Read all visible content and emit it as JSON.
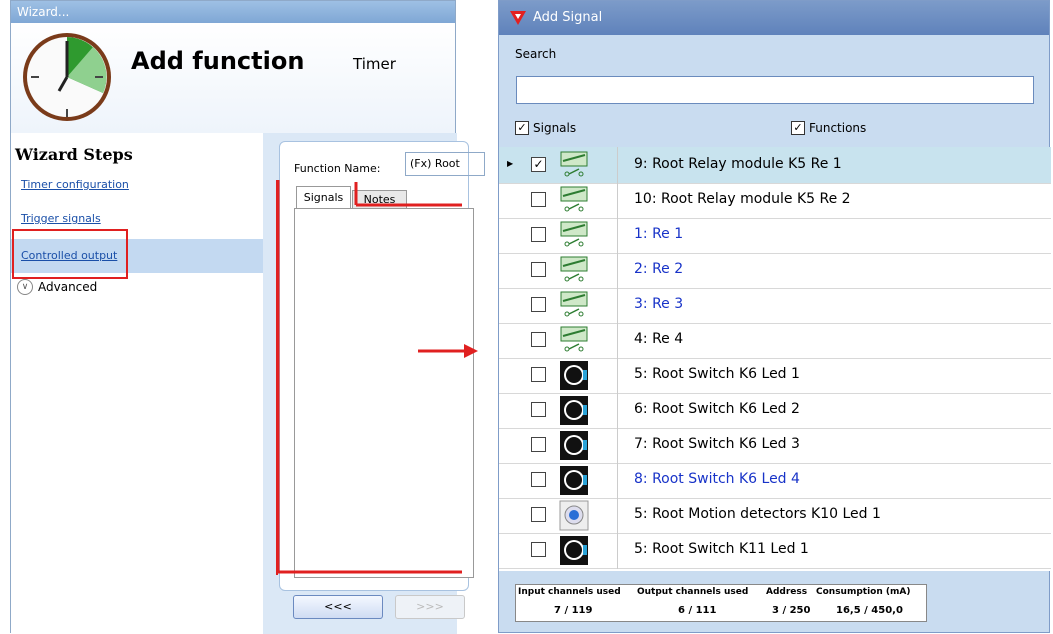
{
  "wizard": {
    "title": "Wizard...",
    "heading": "Add function",
    "subheading": "Timer",
    "steps_title": "Wizard Steps",
    "steps": [
      {
        "label": "Timer configuration"
      },
      {
        "label": "Trigger signals"
      },
      {
        "label": "Controlled output"
      }
    ],
    "advanced_label": "Advanced",
    "function_name_label": "Function Name:",
    "function_name_value": "(Fx) Root",
    "tabs": [
      {
        "label": "Signals"
      },
      {
        "label": "Notes"
      }
    ],
    "back_button": "<<<",
    "next_button": ">>>"
  },
  "add_signal": {
    "title": "Add Signal",
    "search_label": "Search",
    "search_value": "",
    "filter_signals": "Signals",
    "filter_functions": "Functions",
    "rows": [
      {
        "label": "9: Root Relay module K5 Re 1",
        "checked": true,
        "icon": "relay-icon",
        "color": "#000000"
      },
      {
        "label": "10: Root Relay module K5 Re 2",
        "checked": false,
        "icon": "relay-icon",
        "color": "#000000"
      },
      {
        "label": "1: Re 1",
        "checked": false,
        "icon": "relay-icon",
        "color": "#1833c8"
      },
      {
        "label": "2: Re 2",
        "checked": false,
        "icon": "relay-icon",
        "color": "#1833c8"
      },
      {
        "label": "3: Re 3",
        "checked": false,
        "icon": "relay-icon",
        "color": "#1833c8"
      },
      {
        "label": "4: Re 4",
        "checked": false,
        "icon": "relay-icon",
        "color": "#000000"
      },
      {
        "label": "5: Root Switch K6 Led 1",
        "checked": false,
        "icon": "switch-icon",
        "color": "#000000"
      },
      {
        "label": "6: Root Switch K6 Led 2",
        "checked": false,
        "icon": "switch-icon",
        "color": "#000000"
      },
      {
        "label": "7: Root Switch K6 Led 3",
        "checked": false,
        "icon": "switch-icon",
        "color": "#000000"
      },
      {
        "label": "8: Root Switch K6 Led 4",
        "checked": false,
        "icon": "switch-icon",
        "color": "#1833c8"
      },
      {
        "label": "5: Root Motion detectors K10 Led 1",
        "checked": false,
        "icon": "motion-detector-icon",
        "color": "#000000"
      },
      {
        "label": "5: Root Switch K11 Led 1",
        "checked": false,
        "icon": "switch-icon",
        "color": "#000000"
      }
    ],
    "status": {
      "input_label": "Input channels used",
      "input_value": "7 / 119",
      "output_label": "Output channels used",
      "output_value": "6 / 111",
      "address_label": "Address",
      "address_value": "3 / 250",
      "consumption_label": "Consumption (mA)",
      "consumption_value": "16,5 / 450,0"
    }
  }
}
